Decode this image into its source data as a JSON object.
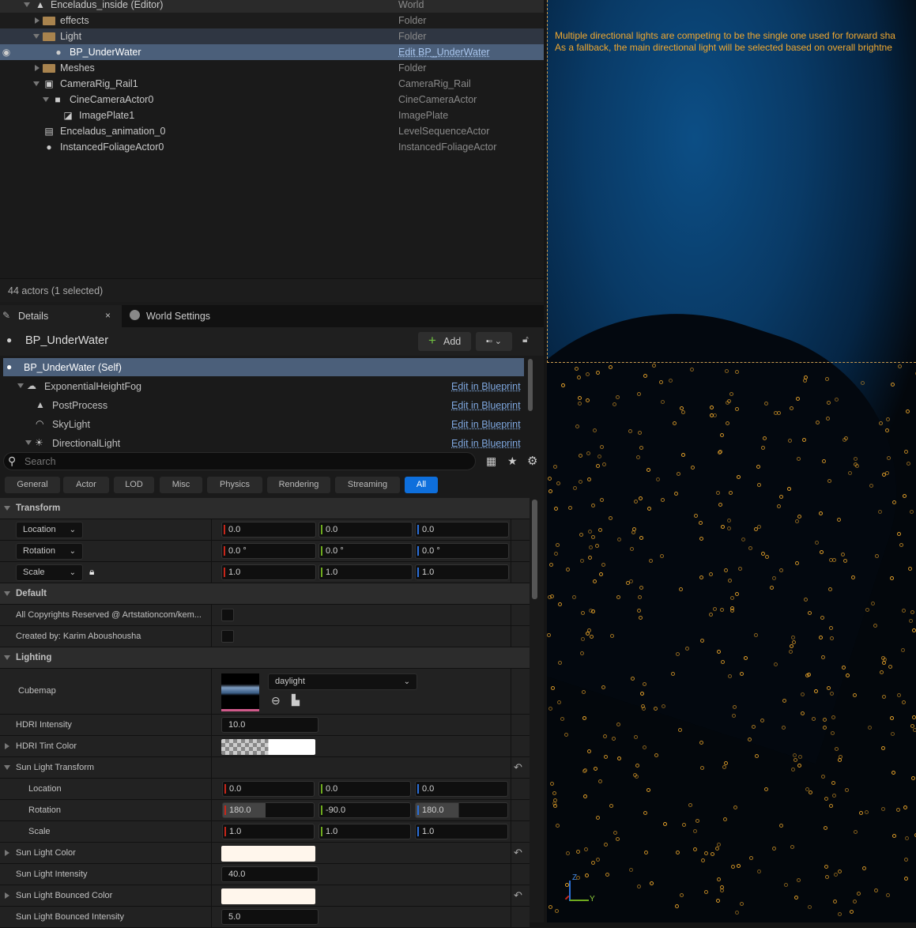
{
  "outliner": {
    "rows": [
      {
        "name": "Enceladus_inside (Editor)",
        "type": "World"
      },
      {
        "name": "effects",
        "type": "Folder"
      },
      {
        "name": "Light",
        "type": "Folder"
      },
      {
        "name": "BP_UnderWater",
        "type": "Edit BP_UnderWater"
      },
      {
        "name": "Meshes",
        "type": "Folder"
      },
      {
        "name": "CameraRig_Rail1",
        "type": "CameraRig_Rail"
      },
      {
        "name": "CineCameraActor0",
        "type": "CineCameraActor"
      },
      {
        "name": "ImagePlate1",
        "type": "ImagePlate"
      },
      {
        "name": "Enceladus_animation_0",
        "type": "LevelSequenceActor"
      },
      {
        "name": "InstancedFoliageActor0",
        "type": "InstancedFoliageActor"
      }
    ],
    "status": "44 actors (1 selected)"
  },
  "tabs": {
    "details": "Details",
    "world_settings": "World Settings",
    "close": "×"
  },
  "details": {
    "actor_name": "BP_UnderWater",
    "add_label": "Add",
    "components": [
      {
        "name": "BP_UnderWater (Self)",
        "link": ""
      },
      {
        "name": "ExponentialHeightFog",
        "link": "Edit in Blueprint"
      },
      {
        "name": "PostProcess",
        "link": "Edit in Blueprint"
      },
      {
        "name": "SkyLight",
        "link": "Edit in Blueprint"
      },
      {
        "name": "DirectionalLight",
        "link": "Edit in Blueprint"
      }
    ],
    "search_placeholder": "Search",
    "filters": [
      "General",
      "Actor",
      "LOD",
      "Misc",
      "Physics",
      "Rendering",
      "Streaming",
      "All"
    ],
    "active_filter": "All",
    "sections": {
      "transform": "Transform",
      "default": "Default",
      "lighting": "Lighting"
    },
    "transform": {
      "location": {
        "label": "Location",
        "values": [
          "0.0",
          "0.0",
          "0.0"
        ]
      },
      "rotation": {
        "label": "Rotation",
        "values": [
          "0.0 °",
          "0.0 °",
          "0.0 °"
        ]
      },
      "scale": {
        "label": "Scale",
        "values": [
          "1.0",
          "1.0",
          "1.0"
        ]
      }
    },
    "default": {
      "copyright": "All Copyrights Reserved @ Artstationcom/kem...",
      "created_by": "Created by: Karim Aboushousha"
    },
    "lighting": {
      "cubemap_label": "Cubemap",
      "cubemap_value": "daylight",
      "hdri_intensity_label": "HDRI Intensity",
      "hdri_intensity": "10.0",
      "hdri_tint_label": "HDRI Tint Color",
      "sun_transform_label": "Sun Light Transform",
      "sun_location": {
        "label": "Location",
        "values": [
          "0.0",
          "0.0",
          "0.0"
        ]
      },
      "sun_rotation": {
        "label": "Rotation",
        "values": [
          "180.0",
          "-90.0",
          "180.0"
        ]
      },
      "sun_scale": {
        "label": "Scale",
        "values": [
          "1.0",
          "1.0",
          "1.0"
        ]
      },
      "sun_color_label": "Sun Light Color",
      "sun_intensity_label": "Sun Light Intensity",
      "sun_intensity": "40.0",
      "bounced_color_label": "Sun Light Bounced Color",
      "bounced_intensity_label": "Sun Light Bounced Intensity",
      "bounced_intensity": "5.0"
    }
  },
  "viewport": {
    "warning_line1": "Multiple directional lights are competing to be the single one used for forward sha",
    "warning_line2": "As a fallback, the main directional light will be selected based on overall brightne",
    "axis_z": "Z",
    "axis_y": "Y"
  },
  "colors": {
    "accent": "#0e6fdc",
    "selection": "#4b5f7a",
    "warning": "#f0a830",
    "axis_x": "#c8261a",
    "axis_y": "#6eaa1e",
    "axis_z": "#2a6fd8"
  }
}
